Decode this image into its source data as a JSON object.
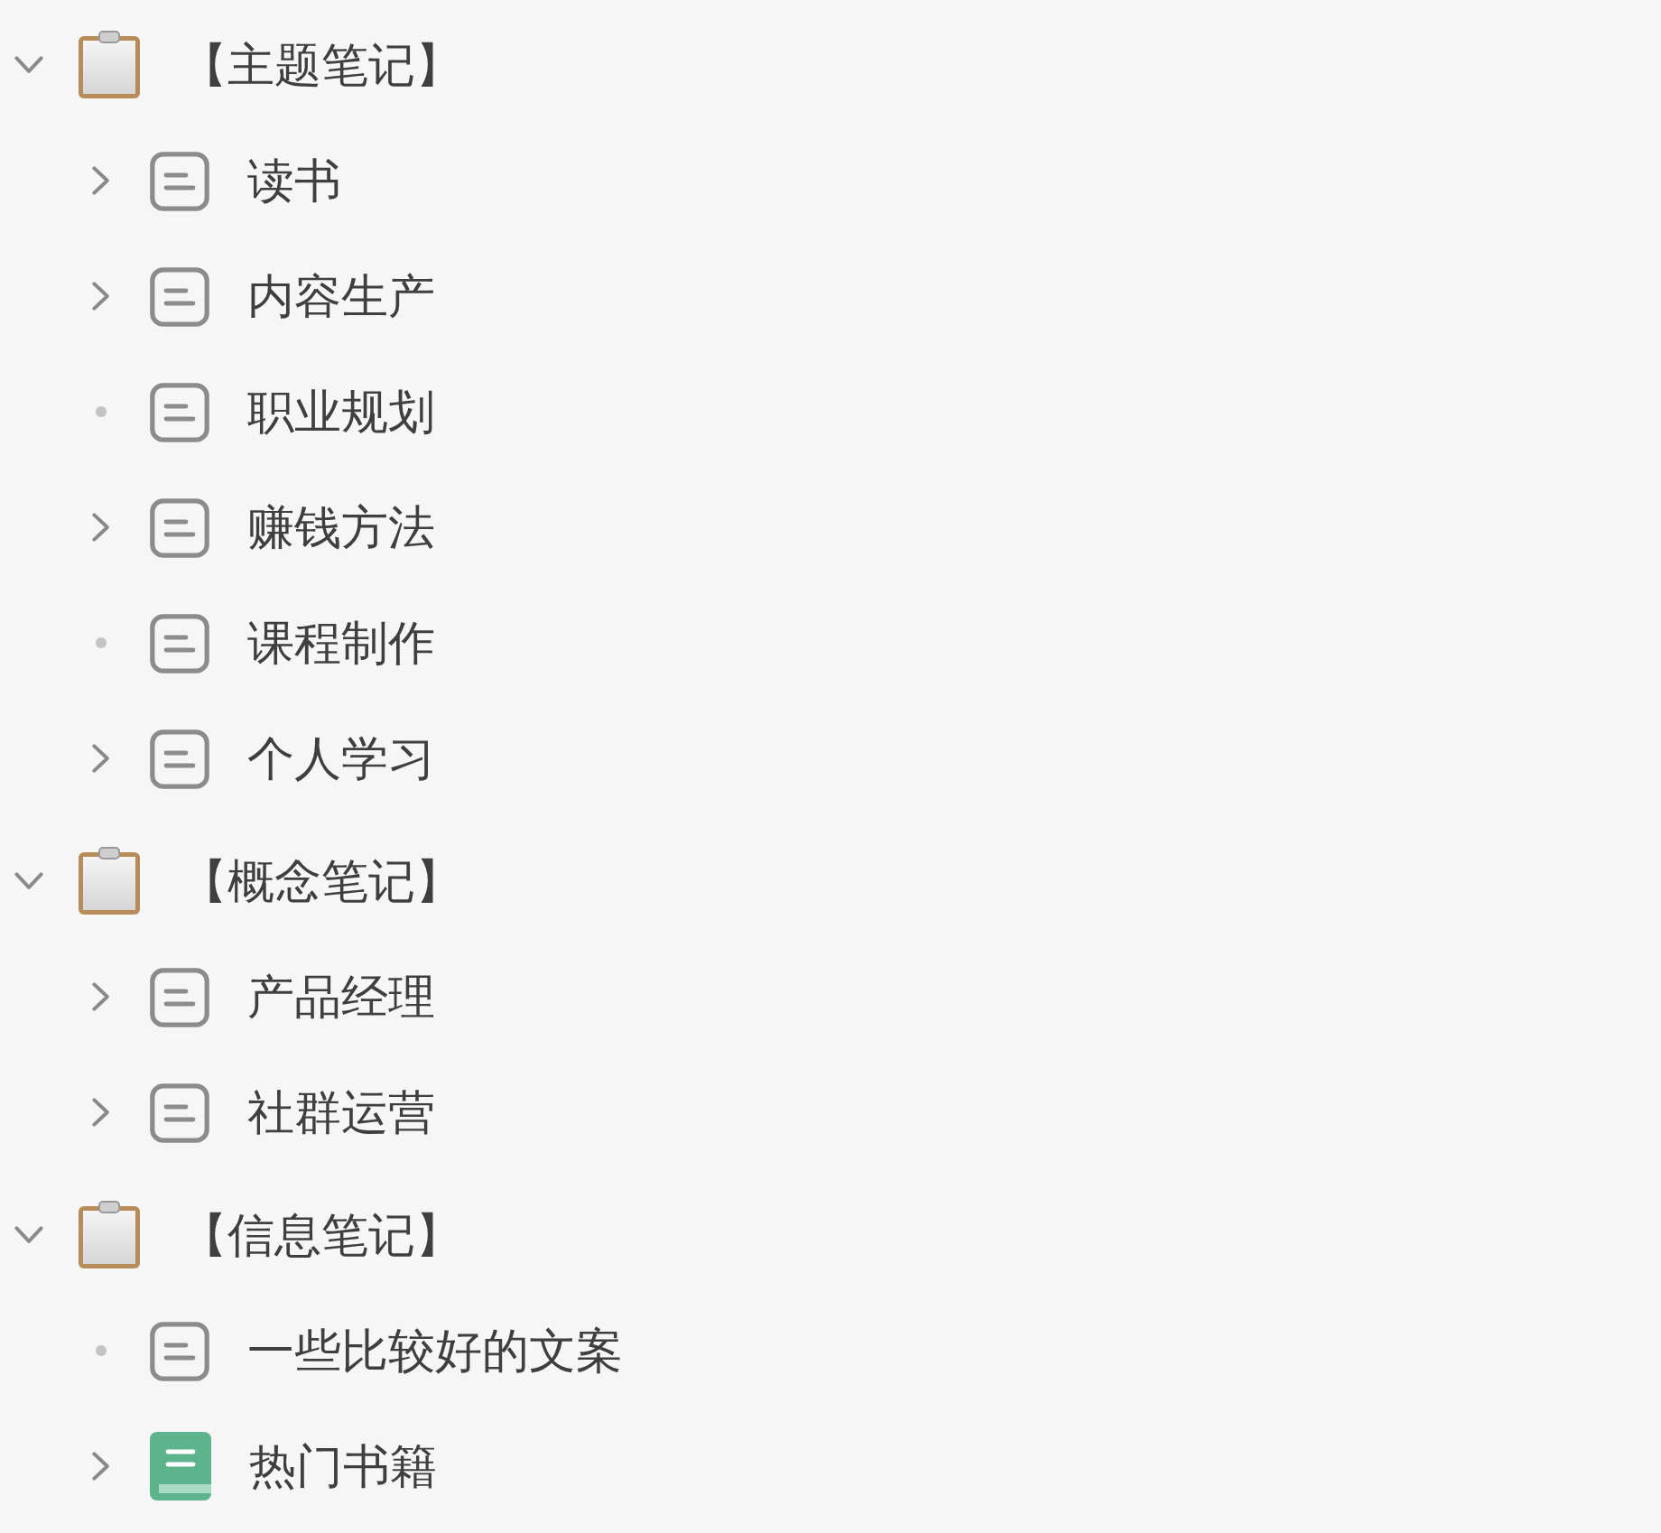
{
  "sections": [
    {
      "label": "【主题笔记】",
      "kind": "notebook",
      "expanded": true,
      "children": [
        {
          "label": "读书",
          "kind": "page",
          "has_children": true,
          "expanded": false
        },
        {
          "label": "内容生产",
          "kind": "page",
          "has_children": true,
          "expanded": false
        },
        {
          "label": "职业规划",
          "kind": "page",
          "has_children": false
        },
        {
          "label": "赚钱方法",
          "kind": "page",
          "has_children": true,
          "expanded": false
        },
        {
          "label": "课程制作",
          "kind": "page",
          "has_children": false
        },
        {
          "label": "个人学习",
          "kind": "page",
          "has_children": true,
          "expanded": false
        }
      ]
    },
    {
      "label": "【概念笔记】",
      "kind": "notebook",
      "expanded": true,
      "children": [
        {
          "label": "产品经理",
          "kind": "page",
          "has_children": true,
          "expanded": false
        },
        {
          "label": "社群运营",
          "kind": "page",
          "has_children": true,
          "expanded": false
        }
      ]
    },
    {
      "label": "【信息笔记】",
      "kind": "notebook",
      "expanded": true,
      "children": [
        {
          "label": "一些比较好的文案",
          "kind": "page",
          "has_children": false
        },
        {
          "label": "热门书籍",
          "kind": "book",
          "has_children": true,
          "expanded": false
        }
      ]
    }
  ]
}
